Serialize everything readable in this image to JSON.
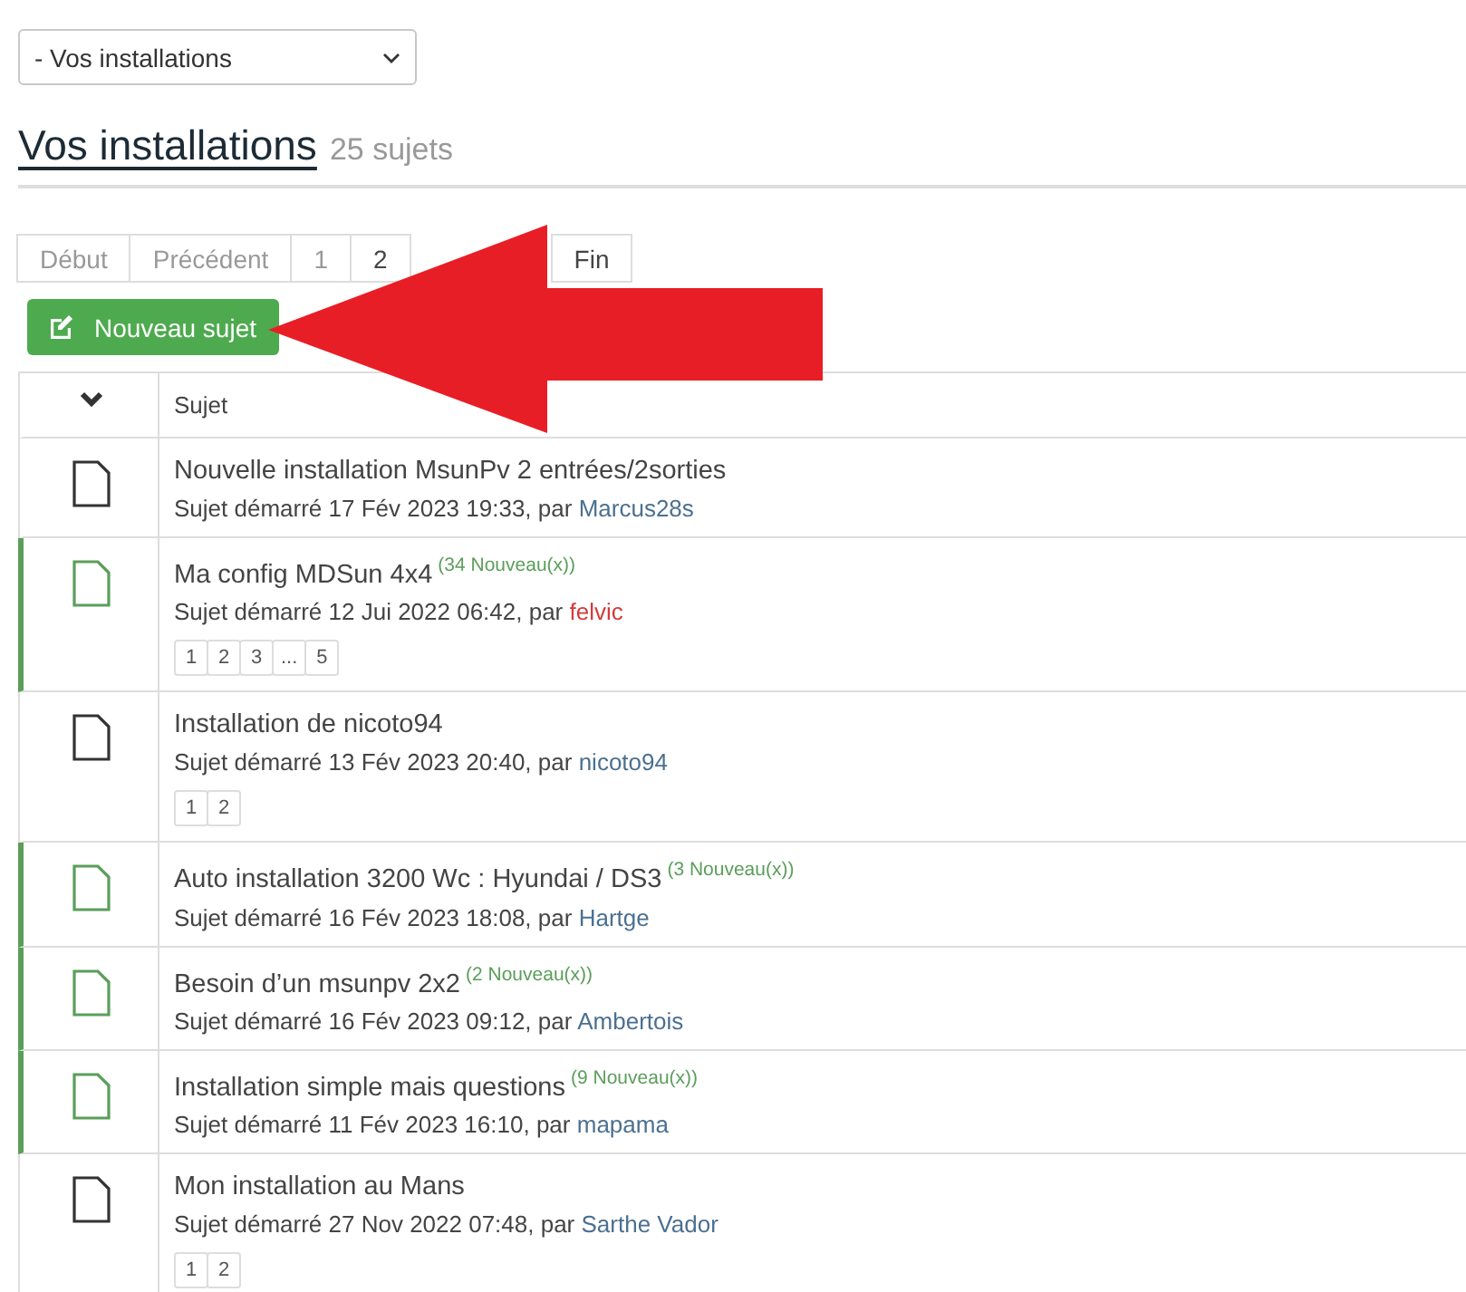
{
  "forum_select": {
    "value": "- Vos installations"
  },
  "heading": {
    "title": "Vos installations",
    "count": "25 sujets"
  },
  "pagination": [
    {
      "label": "Début",
      "disabled": true
    },
    {
      "label": "Précédent",
      "disabled": true
    },
    {
      "label": "1",
      "disabled": true
    },
    {
      "label": "2",
      "disabled": false
    },
    {
      "label": "Fin",
      "disabled": false
    }
  ],
  "new_topic_button": "Nouveau sujet",
  "table": {
    "columns": [
      "Sujet"
    ],
    "rows": [
      {
        "title": "Nouvelle installation MsunPv 2 entrées/2sorties",
        "unread": false,
        "started": "Sujet démarré 17 Fév 2023 19:33, par",
        "author": "Marcus28s",
        "color": "#4b7090"
      },
      {
        "title": "Ma config MDSun 4x4",
        "new_count": "(34 Nouveau(x))",
        "unread": true,
        "started": "Sujet démarré 12 Jui 2022 06:42, par",
        "author": "felvic",
        "color": "#d43a3a",
        "pages": [
          "1",
          "2",
          "3",
          "...",
          "5"
        ]
      },
      {
        "title": "Installation de nicoto94",
        "unread": false,
        "started": "Sujet démarré 13 Fév 2023 20:40, par",
        "author": "nicoto94",
        "color": "#4b7090",
        "pages": [
          "1",
          "2"
        ]
      },
      {
        "title": "Auto installation 3200 Wc : Hyundai / DS3",
        "new_count": "(3 Nouveau(x))",
        "unread": true,
        "started": "Sujet démarré 16 Fév 2023 18:08, par",
        "author": "Hartge",
        "color": "#4b7090"
      },
      {
        "title": "Besoin d’un msunpv 2x2",
        "new_count": "(2 Nouveau(x))",
        "unread": true,
        "started": "Sujet démarré 16 Fév 2023 09:12, par",
        "author": "Ambertois",
        "color": "#4b7090"
      },
      {
        "title": "Installation simple mais questions",
        "new_count": "(9 Nouveau(x))",
        "unread": true,
        "started": "Sujet démarré 11 Fév 2023 16:10, par",
        "author": "mapama",
        "color": "#4b7090"
      },
      {
        "title": "Mon installation au Mans",
        "unread": false,
        "started": "Sujet démarré 27 Nov 2022 07:48, par",
        "author": "Sarthe Vador",
        "color": "#4b7090",
        "pages": [
          "1",
          "2"
        ]
      }
    ]
  }
}
